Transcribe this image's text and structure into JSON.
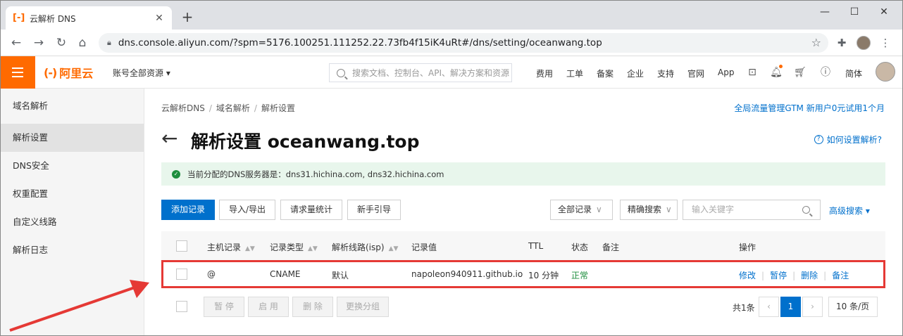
{
  "browser": {
    "tab_title": "云解析 DNS",
    "tab_favicon": "[-]",
    "url": "dns.console.aliyun.com/?spm=5176.100251.111252.22.73fb4f15iK4uRt#/dns/setting/oceanwang.top"
  },
  "topbar": {
    "logo_mark": "(-)",
    "logo_text": "阿里云",
    "account": "账号全部资源 ▾",
    "search_placeholder": "搜索文档、控制台、API、解决方案和资源",
    "nav": [
      "费用",
      "工单",
      "备案",
      "企业",
      "支持",
      "官网",
      "App"
    ],
    "lang": "简体"
  },
  "sidebar": {
    "items": [
      {
        "label": "域名解析"
      },
      {
        "label": "解析设置"
      },
      {
        "label": "DNS安全"
      },
      {
        "label": "权重配置"
      },
      {
        "label": "自定义线路"
      },
      {
        "label": "解析日志"
      }
    ]
  },
  "main": {
    "breadcrumb": [
      "云解析DNS",
      "域名解析",
      "解析设置"
    ],
    "promo": "全局流量管理GTM 新用户0元试用1个月",
    "title": "解析设置 oceanwang.top",
    "help": "如何设置解析?",
    "notice": "当前分配的DNS服务器是：dns31.hichina.com, dns32.hichina.com",
    "buttons": {
      "add": "添加记录",
      "import": "导入/导出",
      "stats": "请求量统计",
      "guide": "新手引导"
    },
    "filter_all": "全部记录",
    "filter_exact": "精确搜索",
    "keyword_placeholder": "输入关键字",
    "advanced": "高级搜索 ▾"
  },
  "table": {
    "headers": {
      "host": "主机记录",
      "type": "记录类型",
      "line": "解析线路(isp)",
      "value": "记录值",
      "ttl": "TTL",
      "status": "状态",
      "remark": "备注",
      "ops": "操作"
    },
    "rows": [
      {
        "host": "@",
        "type": "CNAME",
        "line": "默认",
        "value": "napoleon940911.github.io",
        "ttl": "10 分钟",
        "status": "正常",
        "remark": "",
        "ops": [
          "修改",
          "暂停",
          "删除",
          "备注"
        ]
      }
    ]
  },
  "batch": {
    "pause": "暂 停",
    "enable": "启 用",
    "delete": "删 除",
    "change_group": "更换分组"
  },
  "pagination": {
    "total": "共1条",
    "current": "1",
    "page_size": "10 条/页"
  },
  "colors": {
    "brand": "#ff6a00",
    "link": "#0070cc",
    "annotation": "#e53935"
  }
}
